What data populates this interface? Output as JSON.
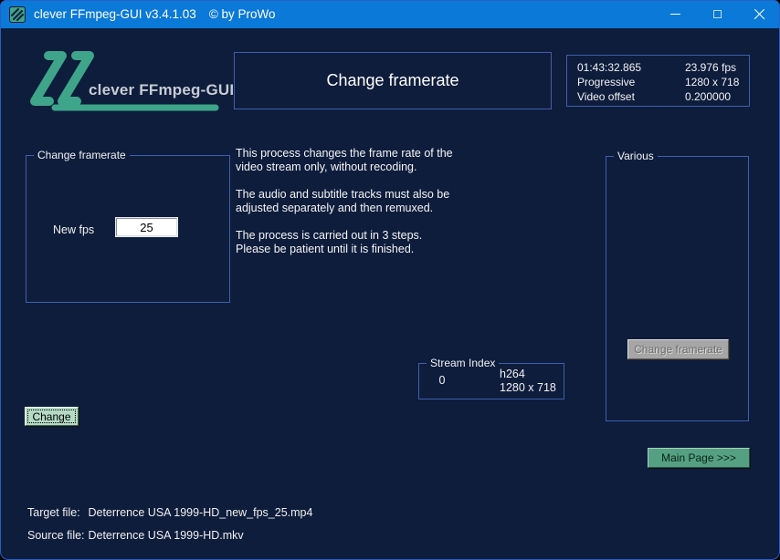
{
  "window": {
    "title": "clever FFmpeg-GUI v3.4.1.03",
    "copyright": "© by ProWo"
  },
  "icons": {
    "app_icon": "green-striped-logo-square",
    "minimize": "minimize-bar",
    "maximize": "maximize-square",
    "close": "close-x"
  },
  "colors": {
    "titlebar": "#0b79d8",
    "background": "#0e1d3c",
    "box_border": "#3e5fae",
    "logo_green": "#3ea58a",
    "focus_button_green": "#b4dac4",
    "action_button_green": "#55a083",
    "disabled_button_gray": "#a6a6a6"
  },
  "logo": {
    "text": "clever FFmpeg-GUI"
  },
  "header": {
    "title": "Change framerate"
  },
  "video_info": {
    "rows": [
      {
        "label": "01:43:32.865",
        "value": "23.976 fps"
      },
      {
        "label": "Progressive",
        "value": "1280 x 718"
      },
      {
        "label": "Video offset",
        "value": "0.200000"
      }
    ]
  },
  "framerate_group": {
    "legend": "Change framerate",
    "new_fps_label": "New fps",
    "new_fps_value": "25"
  },
  "description": {
    "text": "This process changes the frame rate of the\nvideo stream only, without recoding.\n\nThe audio and subtitle tracks must also be\nadjusted separately and then remuxed.\n\nThe process is carried out in 3 steps.\nPlease be patient until it is finished."
  },
  "various_group": {
    "legend": "Various",
    "change_framerate_button": "Change framerate"
  },
  "stream_index_group": {
    "legend": "Stream Index",
    "index": "0",
    "codec": "h264",
    "resolution": "1280 x 718"
  },
  "actions": {
    "change_button": "Change",
    "main_page_button": "Main Page >>>"
  },
  "files": {
    "target_label": "Target file:",
    "target_value": "Deterrence USA 1999-HD_new_fps_25.mp4",
    "source_label": "Source file:",
    "source_value": "Deterrence USA 1999-HD.mkv"
  }
}
